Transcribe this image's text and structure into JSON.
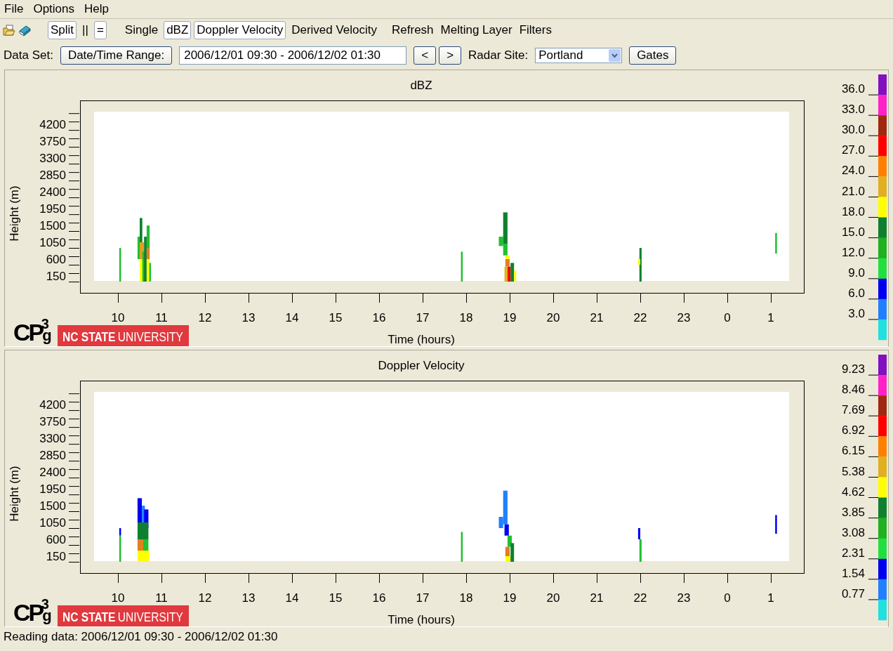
{
  "menu": [
    "File",
    "Options",
    "Help"
  ],
  "toolbar": {
    "view_toggles": [
      {
        "label": "Split",
        "selected": true
      },
      {
        "label": "||",
        "selected": false
      },
      {
        "label": "=",
        "selected": true
      }
    ],
    "display_toggles": [
      {
        "label": "Single",
        "selected": false
      },
      {
        "label": "dBZ",
        "selected": true
      },
      {
        "label": "Doppler Velocity",
        "selected": true
      },
      {
        "label": "Derived Velocity",
        "selected": false
      }
    ],
    "actions": [
      "Refresh",
      "Melting Layer",
      "Filters"
    ]
  },
  "data_set": {
    "label": "Data Set:",
    "range_button": "Date/Time Range:",
    "range_value": "2006/12/01 09:30 - 2006/12/02 01:30",
    "prev_button": "<",
    "next_button": ">",
    "site_label": "Radar Site:",
    "site": "Portland",
    "gates_button": "Gates"
  },
  "panels": [
    {
      "title": "dBZ",
      "ylabel": "Height (m)",
      "yticks": [
        "4200",
        "3750",
        "3300",
        "2850",
        "2400",
        "1950",
        "1500",
        "1050",
        "600",
        "150"
      ],
      "xlabel": "Time (hours)",
      "xticks": [
        "10",
        "11",
        "12",
        "13",
        "14",
        "15",
        "16",
        "17",
        "18",
        "19",
        "20",
        "21",
        "22",
        "23",
        "0",
        "1"
      ],
      "logo": {
        "main": "CP",
        "sub": "g",
        "sup": "3"
      },
      "university": {
        "bold": "NC STATE",
        "regular": "UNIVERSITY"
      },
      "colorbar": {
        "bands": [
          {
            "color": "#8010c0"
          },
          {
            "color": "#ff20c8"
          },
          {
            "color": "#a02810"
          },
          {
            "color": "#ff0000"
          },
          {
            "color": "#ff8000"
          },
          {
            "color": "#e0b020"
          },
          {
            "color": "#ffff00"
          },
          {
            "color": "#108030"
          },
          {
            "color": "#20b020"
          },
          {
            "color": "#20e040"
          },
          {
            "color": "#0000f0"
          },
          {
            "color": "#2080ff"
          },
          {
            "color": "#20e0e0"
          }
        ],
        "labels": [
          "36.0",
          "33.0",
          "30.0",
          "27.0",
          "24.0",
          "21.0",
          "18.0",
          "15.0",
          "12.0",
          "9.0",
          "6.0",
          "3.0"
        ]
      }
    },
    {
      "title": "Doppler Velocity",
      "ylabel": "Height (m)",
      "yticks": [
        "4200",
        "3750",
        "3300",
        "2850",
        "2400",
        "1950",
        "1500",
        "1050",
        "600",
        "150"
      ],
      "xlabel": "Time (hours)",
      "xticks": [
        "10",
        "11",
        "12",
        "13",
        "14",
        "15",
        "16",
        "17",
        "18",
        "19",
        "20",
        "21",
        "22",
        "23",
        "0",
        "1"
      ],
      "logo": {
        "main": "CP",
        "sub": "g",
        "sup": "3"
      },
      "university": {
        "bold": "NC STATE",
        "regular": "UNIVERSITY"
      },
      "colorbar": {
        "bands": [
          {
            "color": "#8010c0"
          },
          {
            "color": "#ff20c8"
          },
          {
            "color": "#a02810"
          },
          {
            "color": "#ff0000"
          },
          {
            "color": "#ff8000"
          },
          {
            "color": "#e0b020"
          },
          {
            "color": "#ffff00"
          },
          {
            "color": "#108030"
          },
          {
            "color": "#20b020"
          },
          {
            "color": "#20e040"
          },
          {
            "color": "#0000f0"
          },
          {
            "color": "#2080ff"
          },
          {
            "color": "#20e0e0"
          }
        ],
        "labels": [
          "9.23",
          "8.46",
          "7.69",
          "6.92",
          "6.15",
          "5.38",
          "4.62",
          "3.85",
          "3.08",
          "2.31",
          "1.54",
          "0.77"
        ]
      }
    }
  ],
  "status_bar": "Reading data: 2006/12/01 09:30 - 2006/12/02 01:30"
}
